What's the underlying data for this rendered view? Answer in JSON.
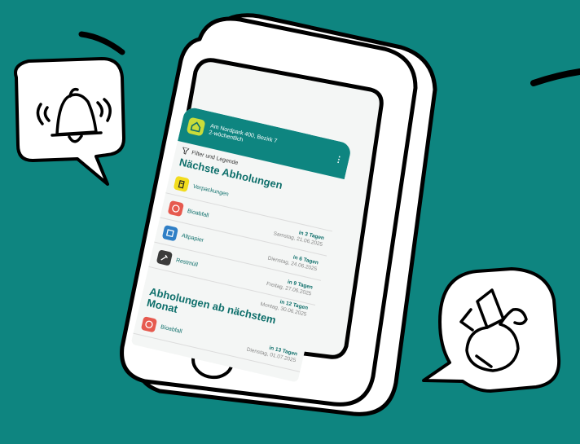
{
  "colors": {
    "background": "#0E8580",
    "accent_dark": "#0E6F6B",
    "yellow": "#F2DC1E",
    "red": "#E65A4F",
    "blue": "#2F7FC6",
    "dark": "#3b3b3b",
    "home_green": "#c9dc3a"
  },
  "app": {
    "address": "Am Nordpark 400, Bezirk 7",
    "frequency": "2-wöchentlich",
    "menu_icon": "more-vertical-icon",
    "filter_label": "Filter und Legende"
  },
  "sections": [
    {
      "title": "Nächste Abholungen",
      "items": [
        {
          "name": "Verpackungen",
          "icon": "packaging-icon",
          "color": "#F2DC1E",
          "relative": "",
          "date": ""
        },
        {
          "name": "Bioabfall",
          "icon": "biowaste-icon",
          "color": "#E65A4F",
          "relative": "in 3 Tagen",
          "date": "Samstag, 21.06.2025"
        },
        {
          "name": "Altpapier",
          "icon": "paper-icon",
          "color": "#2F7FC6",
          "relative": "in 6 Tagen",
          "date": "Dienstag, 24.06.2025"
        },
        {
          "name": "Restmüll",
          "icon": "residual-waste-icon",
          "color": "#3b3b3b",
          "relative": "in 9 Tagen",
          "date": "Freitag, 27.06.2025"
        },
        {
          "name": "",
          "icon": "",
          "color": "",
          "relative": "in 12 Tagen",
          "date": "Montag, 30.06.2025"
        }
      ]
    },
    {
      "title": "Abholungen ab nächstem Monat",
      "items": [
        {
          "name": "Bioabfall",
          "icon": "biowaste-icon",
          "color": "#E65A4F",
          "relative": "in 13 Tagen",
          "date": "Dienstag, 01.07.2025"
        }
      ]
    }
  ],
  "decor": {
    "left_bubble_icon": "ringing-bell-icon",
    "right_bubble_icon": "garbage-bags-icon"
  }
}
